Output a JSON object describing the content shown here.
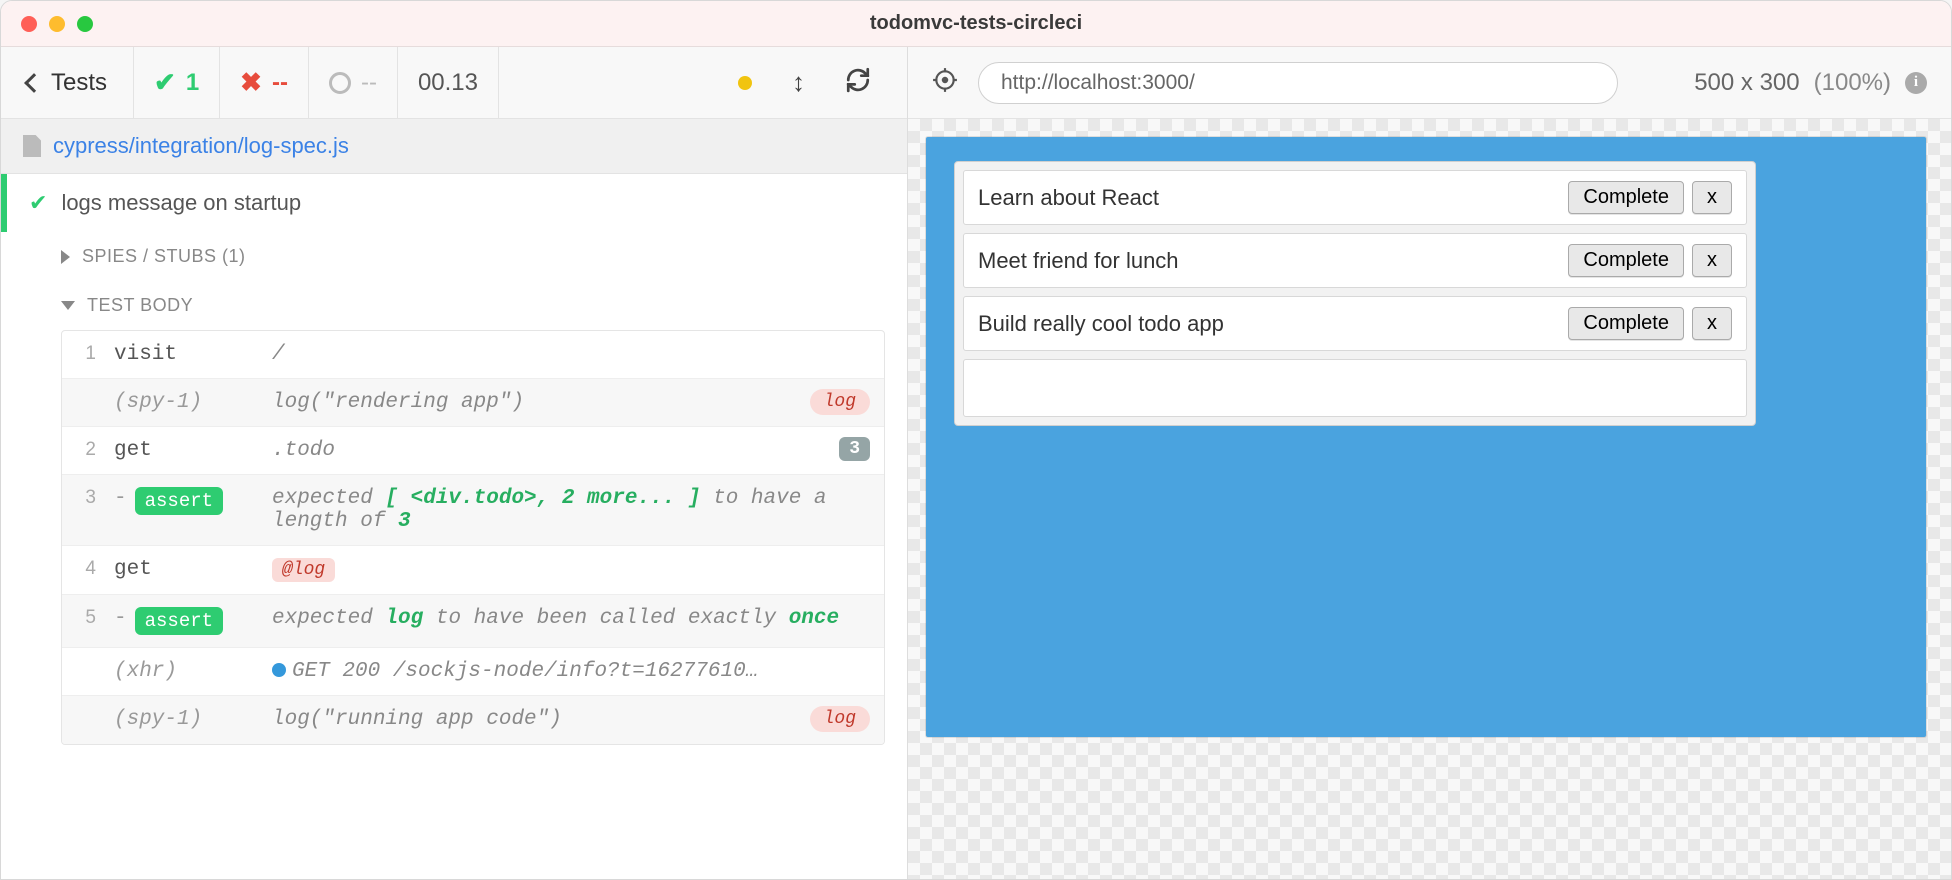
{
  "window": {
    "title": "todomvc-tests-circleci"
  },
  "header": {
    "tests_label": "Tests",
    "passed": "1",
    "failed": "--",
    "pending": "--",
    "time": "00.13"
  },
  "spec": {
    "path": "cypress/integration/log-spec.js"
  },
  "test": {
    "title": "logs message on startup",
    "spies_label": "SPIES / STUBS (1)",
    "body_label": "TEST BODY"
  },
  "commands": [
    {
      "num": "1",
      "name": "visit",
      "msg_plain": "/",
      "alt": false
    },
    {
      "num": "",
      "name": "(spy-1)",
      "name_italic": true,
      "msg_plain": "log(\"rendering app\")",
      "badge": "log",
      "badge_class": "pill-log",
      "alt": true
    },
    {
      "num": "2",
      "name": "get",
      "msg_plain": ".todo",
      "badge": "3",
      "badge_class": "pill-count",
      "alt": false
    },
    {
      "num": "3",
      "assert": true,
      "msg_html": "expected <b>[ &lt;div.todo&gt;, 2 more... ]</b> to have a length of <b>3</b>",
      "alt": true
    },
    {
      "num": "4",
      "name": "get",
      "alias": "@log",
      "alt": false
    },
    {
      "num": "5",
      "assert": true,
      "msg_html": "expected <b>log</b> to have been called exactly <b>once</b>",
      "alt": true
    },
    {
      "num": "",
      "name": "(xhr)",
      "name_italic": true,
      "xhr": true,
      "msg_plain": "GET 200 /sockjs-node/info?t=16277610…",
      "alt": false
    },
    {
      "num": "",
      "name": "(spy-1)",
      "name_italic": true,
      "msg_plain": "log(\"running app code\")",
      "badge": "log",
      "badge_class": "pill-log",
      "alt": true
    }
  ],
  "aut": {
    "url": "http://localhost:3000/",
    "viewport": "500 x 300",
    "scale": "(100%)"
  },
  "app": {
    "todos": [
      {
        "text": "Learn about React",
        "complete_label": "Complete",
        "delete_label": "x"
      },
      {
        "text": "Meet friend for lunch",
        "complete_label": "Complete",
        "delete_label": "x"
      },
      {
        "text": "Build really cool todo app",
        "complete_label": "Complete",
        "delete_label": "x"
      }
    ]
  }
}
